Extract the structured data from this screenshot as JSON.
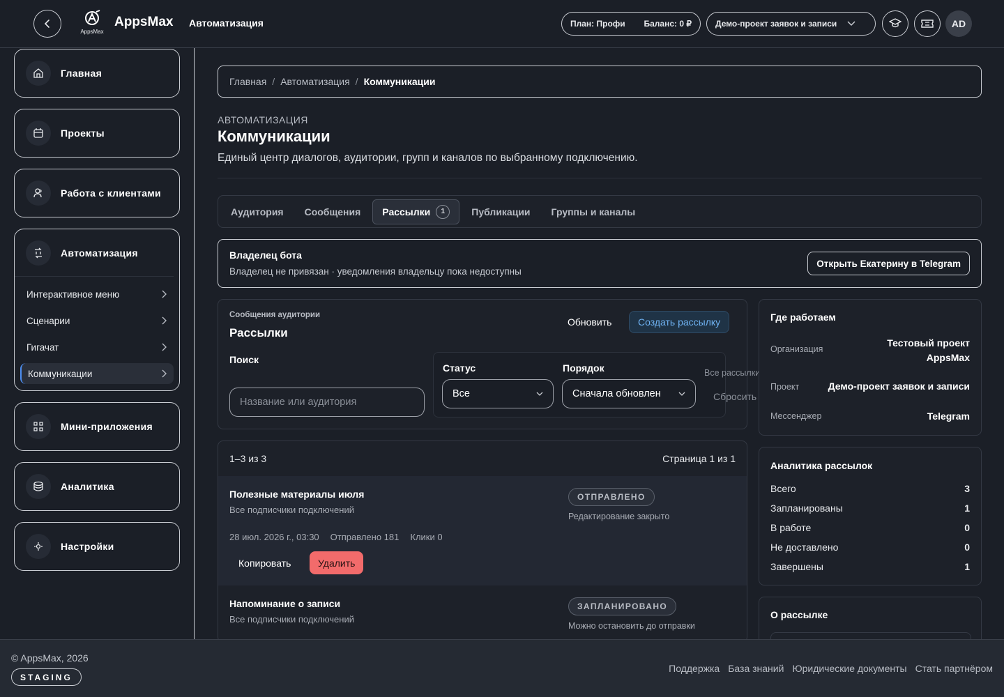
{
  "header": {
    "app_name": "AppsMax",
    "logo_sub": "AppsMax",
    "section": "Автоматизация",
    "plan": "План: Профи",
    "balance": "Баланс: 0 ₽",
    "project": "Демо-проект заявок и записи",
    "avatar": "AD"
  },
  "sidebar": {
    "items": [
      {
        "label": "Главная",
        "icon": "home-icon"
      },
      {
        "label": "Проекты",
        "icon": "calendar-icon"
      },
      {
        "label": "Работа с клиентами",
        "icon": "users-icon"
      },
      {
        "label": "Автоматизация",
        "icon": "automation-icon"
      },
      {
        "label": "Мини-приложения",
        "icon": "apps-icon"
      },
      {
        "label": "Аналитика",
        "icon": "database-icon"
      },
      {
        "label": "Настройки",
        "icon": "settings-icon"
      }
    ],
    "sub_items": [
      {
        "label": "Интерактивное меню"
      },
      {
        "label": "Сценарии"
      },
      {
        "label": "Гигачат"
      },
      {
        "label": "Коммуникации",
        "active": true
      }
    ]
  },
  "breadcrumb": {
    "home": "Главная",
    "section": "Автоматизация",
    "current": "Коммуникации",
    "sep": "/"
  },
  "page": {
    "eyebrow": "АВТОМАТИЗАЦИЯ",
    "title": "Коммуникации",
    "description": "Единый центр диалогов, аудитории, групп и каналов по выбранному подключению."
  },
  "tabs": [
    {
      "label": "Аудитория"
    },
    {
      "label": "Сообщения"
    },
    {
      "label": "Рассылки",
      "badge": "1",
      "active": true
    },
    {
      "label": "Публикации"
    },
    {
      "label": "Группы и каналы"
    }
  ],
  "owner": {
    "title": "Владелец бота",
    "desc": "Владелец не привязан · уведомления владельцу пока недоступны",
    "button": "Открыть Екатерину в Telegram"
  },
  "mailings": {
    "eyebrow": "Сообщения аудитории",
    "title": "Рассылки",
    "refresh": "Обновить",
    "create": "Создать рассылку",
    "search_label": "Поиск",
    "search_placeholder": "Название или аудитория",
    "status_label": "Статус",
    "status_value": "Все",
    "order_label": "Порядок",
    "order_value": "Сначала обновлен",
    "all_mailings": "Все рассылки",
    "reset": "Сбросить",
    "range": "1–3 из 3",
    "page": "Страница 1 из 1",
    "rows": [
      {
        "title": "Полезные материалы июля",
        "audience": "Все подписчики подключений",
        "status": "ОТПРАВЛЕНО",
        "note": "Редактирование закрыто",
        "date": "28 июл. 2026 г., 03:30",
        "sent": "Отправлено 181",
        "clicks": "Клики 0",
        "copy": "Копировать",
        "delete": "Удалить"
      },
      {
        "title": "Напоминание о записи",
        "audience": "Все подписчики подключений",
        "status": "ЗАПЛАНИРОВАНО",
        "note": "Можно остановить до отправки"
      }
    ]
  },
  "where": {
    "title": "Где работаем",
    "org_label": "Организация",
    "org_value_1": "Тестовый проект",
    "org_value_2": "AppsMax",
    "project_label": "Проект",
    "project_value": "Демо-проект заявок и записи",
    "messenger_label": "Мессенджер",
    "messenger_value": "Telegram"
  },
  "analytics": {
    "title": "Аналитика рассылок",
    "rows": [
      {
        "label": "Всего",
        "value": "3"
      },
      {
        "label": "Запланированы",
        "value": "1"
      },
      {
        "label": "В работе",
        "value": "0"
      },
      {
        "label": "Не доставлено",
        "value": "0"
      },
      {
        "label": "Завершены",
        "value": "1"
      }
    ]
  },
  "about": {
    "title": "О рассылке"
  },
  "footer": {
    "copyright": "© AppsMax, 2026",
    "env": "STAGING",
    "links": [
      "Поддержка",
      "База знаний",
      "Юридические документы",
      "Стать партнёром"
    ]
  },
  "colors": {
    "background": "#1b1f27",
    "accent": "#4d8ef0",
    "danger": "#f26b6b",
    "create_btn_bg": "#1f3346"
  }
}
